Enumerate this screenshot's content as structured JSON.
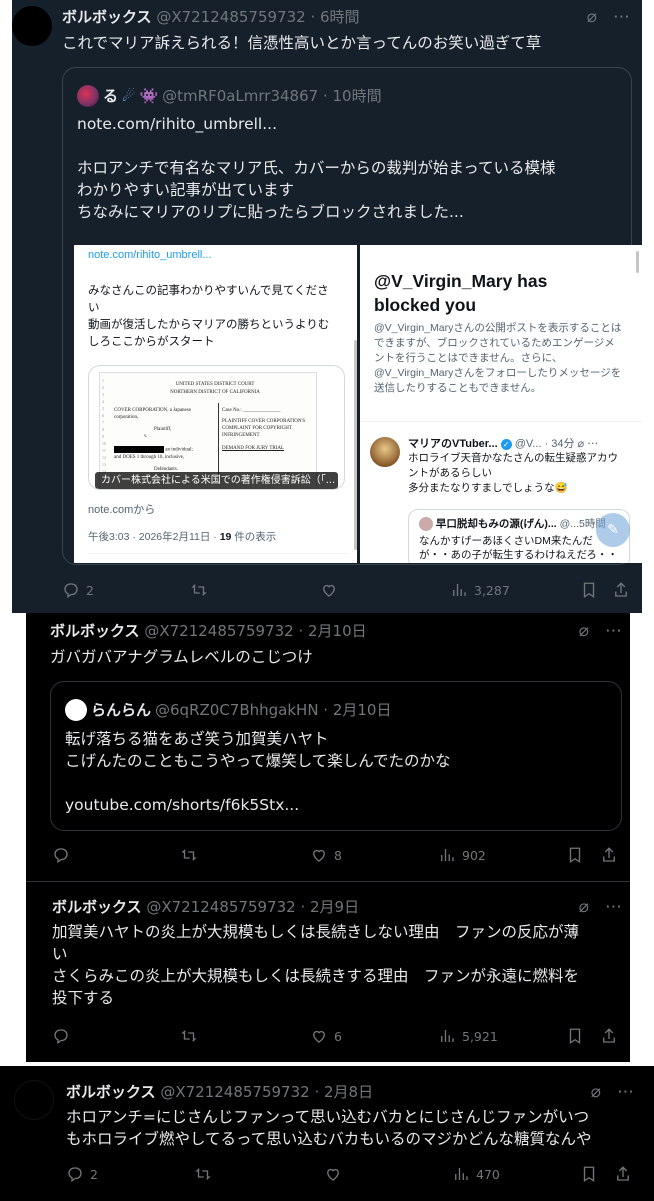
{
  "tweets": [
    {
      "name": "ボルボックス",
      "handle": "@X7212485759732 · 6時間",
      "text": "これでマリア訴えられる！信憑性高いとか言ってんのお笑い過ぎて草",
      "quote": {
        "name": "る",
        "name_emoji": "🧑‍🎤",
        "handle": "@tmRF0aLmrr34867 · 10時間",
        "lines": [
          "note.com/rihito_umbrell...",
          "",
          "ホロアンチで有名なマリア氏、カバーからの裁判が始まっている模様",
          "わかりやすい記事が出ています",
          "ちなみにマリアのリプに貼ったらブロックされました..."
        ]
      },
      "left_image": {
        "url_text": "note.com/rihito_umbrell...",
        "body": [
          "みなさんこの記事わかりやすいんで見てくださ",
          "い",
          "動画が復活したからマリアの勝ちというよりむ",
          "しろここからがスタート"
        ],
        "doc": {
          "court1": "UNITED STATES DISTRICT COURT",
          "court2": "NORTHERN DISTRICT OF CALIFORNIA",
          "party1": "COVER CORPORATION, a Japanese",
          "party2": "corporation,",
          "plaintiff": "Plaintiff,",
          "v": "v.",
          "defendant_tail": "an individual;",
          "does": "and DOES 1 through 10, inclusive,",
          "defendants": "Defendants.",
          "caseno": "Case No.: _______________",
          "complaint": "PLAINTIFF COVER CORPORATION'S COMPLAINT FOR COPYRIGHT INFRINGEMENT",
          "jury": "DEMAND FOR JURY TRIAL",
          "caption": "カバー株式会社による米国での著作権侵害訴訟（「..."
        },
        "source": "note.comから",
        "time_prefix": "午後3:03 · 2026年2月11日 · ",
        "views_num": "19",
        "views_suffix": " 件の表示"
      },
      "right_image": {
        "title": "@V_Virgin_Mary has blocked you",
        "desc": "@V_Virgin_Maryさんの公開ポストを表示することはできますが、ブロックされているためエンゲージメントを行うことはできません。さらに、@V_Virgin_Maryさんをフォローしたりメッセージを送信したりすることもできません。",
        "reply1_name": "マリアのVTuber...",
        "reply1_meta": "@V... · 34分",
        "reply1_lines": [
          "ホロライブ天音かなたさんの転生疑惑アカウ",
          "ントがあるらしい",
          "多分またなりすましでしょうな😅"
        ],
        "reply2_name": "早口脱却もみの源(げん)...",
        "reply2_meta": "@...5時間",
        "reply2_lines": [
          "なんかすげーあほくさいDM来たんだ",
          "が・・あの子が転生するわけねえだろ・・"
        ]
      },
      "actions": {
        "reply": "2",
        "retweet": "",
        "like": "",
        "views": "3,287"
      }
    },
    {
      "name": "ボルボックス",
      "handle": "@X7212485759732 · 2月10日",
      "text": "ガバガバアナグラムレベルのこじつけ",
      "quote": {
        "name": "らんらん",
        "handle": "@6qRZ0C7BhhgakHN · 2月10日",
        "lines": [
          "転げ落ちる猫をあざ笑う加賀美ハヤト",
          "こげんたのこともこうやって爆笑して楽しんでたのかな",
          "",
          "youtube.com/shorts/f6k5Stx..."
        ]
      },
      "actions": {
        "reply": "",
        "retweet": "",
        "like": "8",
        "views": "902"
      }
    },
    {
      "name": "ボルボックス",
      "handle": "@X7212485759732 · 2月9日",
      "lines": [
        "加賀美ハヤトの炎上が大規模もしくは長続きしない理由　ファンの反応が薄",
        "い",
        "さくらみこの炎上が大規模もしくは長続きする理由　ファンが永遠に燃料を",
        "投下する"
      ],
      "actions": {
        "reply": "",
        "retweet": "",
        "like": "6",
        "views": "5,921"
      }
    },
    {
      "name": "ボルボックス",
      "handle": "@X7212485759732 · 2月8日",
      "lines": [
        "ホロアンチ=にじさんじファンって思い込むバカとにじさんじファンがいつ",
        "もホロライブ燃やしてるって思い込むバカもいるのマジかどんな糖質なんや"
      ],
      "actions": {
        "reply": "2",
        "retweet": "",
        "like": "",
        "views": "470"
      }
    }
  ],
  "colors": {
    "accent": "#1d9bf0",
    "dim_bg": "#15202b",
    "black_bg": "#000000",
    "muted": "#71767b"
  },
  "icons": [
    "grok-slash-icon",
    "more-icon",
    "reply-icon",
    "retweet-icon",
    "like-icon",
    "views-icon",
    "bookmark-icon",
    "share-icon",
    "verified-icon"
  ]
}
